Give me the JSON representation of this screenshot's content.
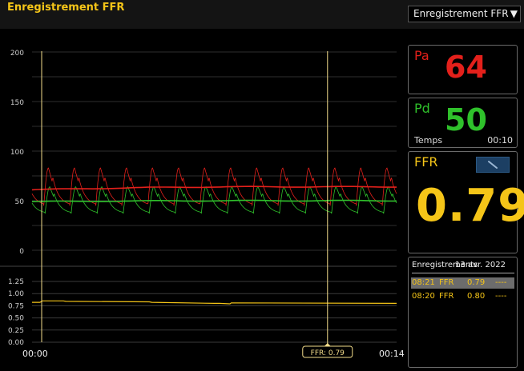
{
  "header": {
    "title": "Enregistrement FFR"
  },
  "mode_select": {
    "value": "Enregistrement FFR",
    "arrow": "▼"
  },
  "pa_panel": {
    "label": "Pa",
    "value": "64"
  },
  "pd_panel": {
    "label": "Pd",
    "value": "50",
    "time_label": "Temps",
    "time_value": "00:10"
  },
  "ffr_panel": {
    "label": "FFR",
    "value": "0.79",
    "tool_icon": "wrench-icon"
  },
  "recordings": {
    "header_label": "Enregistrements",
    "header_date": "13 avr. 2022",
    "rows": [
      {
        "time": "08:21",
        "type": "FFR",
        "value": "0.79",
        "extra": "----",
        "selected": true
      },
      {
        "time": "08:20",
        "type": "FFR",
        "value": "0.80",
        "extra": "----",
        "selected": false
      }
    ]
  },
  "timeline": {
    "start": "00:00",
    "end": "00:14",
    "marker_label": "FFR: 0.79",
    "marker_position": 0.727
  },
  "colors": {
    "pa": "#e3201b",
    "pd": "#2fc12b",
    "ffr": "#f5c518",
    "cursor": "#f2dc8a"
  },
  "chart_data": [
    {
      "type": "line",
      "yticks": [
        0,
        50,
        100,
        150,
        200
      ],
      "ylim": [
        0,
        200
      ],
      "xlim": [
        0,
        14
      ],
      "series": [
        {
          "name": "Pa",
          "beat_max": 83,
          "beat_min": 45,
          "mean_start": 61,
          "mean_end": 64
        },
        {
          "name": "Pd",
          "beat_max": 64,
          "beat_min": 37,
          "mean_start": 49,
          "mean_end": 50
        }
      ]
    },
    {
      "type": "line",
      "yticks": [
        "0.00",
        "0.25",
        "0.50",
        "0.75",
        "1.00",
        "1.25"
      ],
      "ylim": [
        0,
        1.25
      ],
      "xlim": [
        0,
        14
      ],
      "series": [
        {
          "name": "FFR",
          "x": [
            0,
            0.3,
            0.4,
            1.2,
            1.3,
            4.5,
            4.6,
            7.0,
            7.2,
            7.6,
            7.65,
            14
          ],
          "y": [
            0.82,
            0.82,
            0.85,
            0.85,
            0.84,
            0.83,
            0.82,
            0.8,
            0.8,
            0.79,
            0.81,
            0.8
          ]
        }
      ]
    }
  ]
}
